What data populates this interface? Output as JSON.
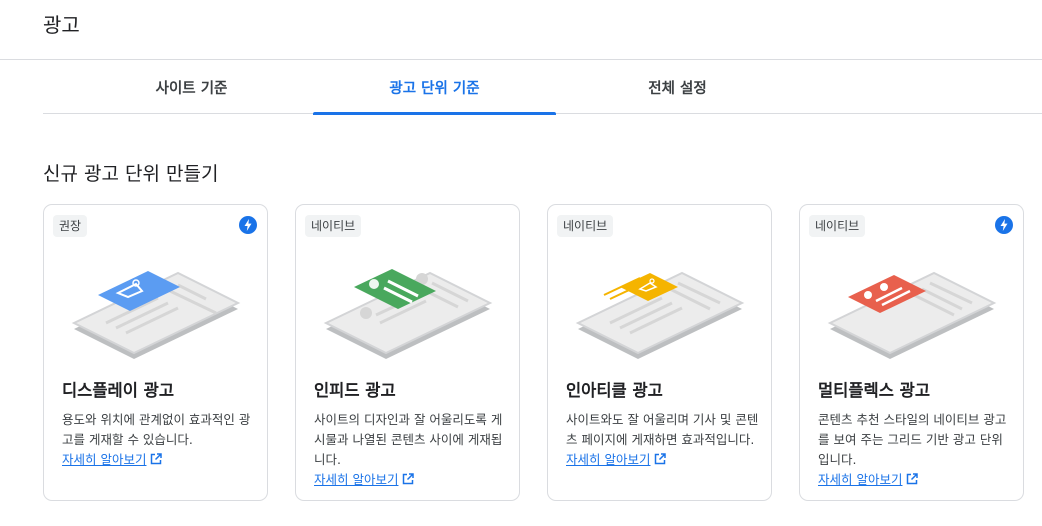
{
  "page": {
    "title": "광고"
  },
  "tabs": [
    {
      "label": "사이트 기준",
      "active": false
    },
    {
      "label": "광고 단위 기준",
      "active": true
    },
    {
      "label": "전체 설정",
      "active": false
    }
  ],
  "section": {
    "title": "신규 광고 단위 만들기"
  },
  "colors": {
    "accent": "#1a73e8",
    "display": "#5b9cf2",
    "infeed": "#49a85d",
    "inarticle": "#f5b400",
    "multiplex": "#e8604d"
  },
  "cards": [
    {
      "badge": "권장",
      "icon": "bolt-icon",
      "illustration": "display-ad-phone",
      "title": "디스플레이 광고",
      "description": "용도와 위치에 관계없이 효과적인 광고를 게재할 수 있습니다.",
      "link": "자세히 알아보기"
    },
    {
      "badge": "네이티브",
      "illustration": "infeed-ad-phone",
      "title": "인피드 광고",
      "description": "사이트의 디자인과 잘 어울리도록 게시물과 나열된 콘텐츠 사이에 게재됩니다.",
      "link": "자세히 알아보기"
    },
    {
      "badge": "네이티브",
      "illustration": "inarticle-ad-phone",
      "title": "인아티클 광고",
      "description": "사이트와도 잘 어울리며 기사 및 콘텐츠 페이지에 게재하면 효과적입니다.",
      "link": "자세히 알아보기"
    },
    {
      "badge": "네이티브",
      "icon": "bolt-icon",
      "illustration": "multiplex-ad-phone",
      "title": "멀티플렉스 광고",
      "description": "콘텐츠 추천 스타일의 네이티브 광고를 보여 주는 그리드 기반 광고 단위입니다.",
      "link": "자세히 알아보기"
    }
  ]
}
